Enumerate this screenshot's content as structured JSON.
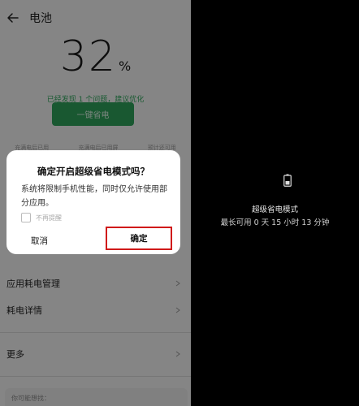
{
  "header": {
    "title": "电池"
  },
  "battery": {
    "percent": "32",
    "unit": "%"
  },
  "optimization": {
    "found_text": "已经发现 1 个问题，建议优化",
    "button_label": "一键省电"
  },
  "stats": [
    {
      "label": "充满电后已用"
    },
    {
      "label": "充满电后已用屏"
    },
    {
      "label": "预计还可用"
    }
  ],
  "dialog": {
    "title": "确定开启超级省电模式吗？",
    "message": "系统将限制手机性能，同时仅允许使用部分应用。",
    "checkbox_label": "不再提醒",
    "cancel_label": "取消",
    "confirm_label": "确定"
  },
  "list": {
    "items": [
      {
        "label": "应用耗电管理"
      },
      {
        "label": "耗电详情"
      },
      {
        "label": "更多"
      }
    ],
    "suggest_label": "你可能想找："
  },
  "super_saver": {
    "mode_label": "超级省电模式",
    "remaining": "最长可用 0 天 15 小时 13 分钟"
  },
  "colors": {
    "accent_green": "#2fa05a",
    "highlight_red": "#d01a1a"
  }
}
